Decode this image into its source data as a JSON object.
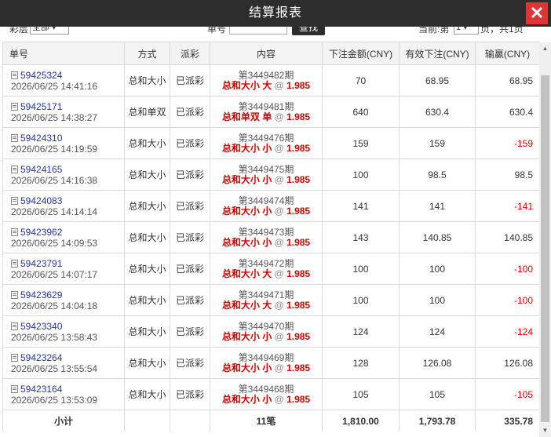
{
  "window": {
    "title": "结算报表",
    "close_label": "✕"
  },
  "filter": {
    "type_label": "彩层",
    "type_value": "全部",
    "order_label": "单号",
    "order_placeholder": "",
    "search_label": "查找",
    "page_label": "当前:第",
    "page_value": "1",
    "page_suffix": "页，共1页"
  },
  "table": {
    "headers": [
      "单号",
      "方式",
      "派彩",
      "内容",
      "下注金额(CNY)",
      "有效下注(CNY)",
      "输赢(CNY)"
    ],
    "rows": [
      {
        "id": "59425324",
        "time": "2026/06/25 14:41:16",
        "method": "总和大小",
        "status": "已派彩",
        "period": "第3449482期",
        "bet": "总和大小 大",
        "odds": "1.985",
        "amount": "70",
        "valid": "68.95",
        "win": "68.95"
      },
      {
        "id": "59425171",
        "time": "2026/06/25 14:38:27",
        "method": "总和单双",
        "status": "已派彩",
        "period": "第3449481期",
        "bet": "总和单双 单",
        "odds": "1.985",
        "amount": "640",
        "valid": "630.4",
        "win": "630.4"
      },
      {
        "id": "59424310",
        "time": "2026/06/25 14:19:59",
        "method": "总和大小",
        "status": "已派彩",
        "period": "第3449476期",
        "bet": "总和大小 小",
        "odds": "1.985",
        "amount": "159",
        "valid": "159",
        "win": "-159"
      },
      {
        "id": "59424165",
        "time": "2026/06/25 14:16:38",
        "method": "总和大小",
        "status": "已派彩",
        "period": "第3449475期",
        "bet": "总和大小 小",
        "odds": "1.985",
        "amount": "100",
        "valid": "98.5",
        "win": "98.5"
      },
      {
        "id": "59424083",
        "time": "2026/06/25 14:14:14",
        "method": "总和大小",
        "status": "已派彩",
        "period": "第3449474期",
        "bet": "总和大小 小",
        "odds": "1.985",
        "amount": "141",
        "valid": "141",
        "win": "-141"
      },
      {
        "id": "59423962",
        "time": "2026/06/25 14:09:53",
        "method": "总和大小",
        "status": "已派彩",
        "period": "第3449473期",
        "bet": "总和大小 小",
        "odds": "1.985",
        "amount": "143",
        "valid": "140.85",
        "win": "140.85"
      },
      {
        "id": "59423791",
        "time": "2026/06/25 14:07:17",
        "method": "总和大小",
        "status": "已派彩",
        "period": "第3449472期",
        "bet": "总和大小 大",
        "odds": "1.985",
        "amount": "100",
        "valid": "100",
        "win": "-100"
      },
      {
        "id": "59423629",
        "time": "2026/06/25 14:04:18",
        "method": "总和大小",
        "status": "已派彩",
        "period": "第3449471期",
        "bet": "总和大小 大",
        "odds": "1.985",
        "amount": "100",
        "valid": "100",
        "win": "-100"
      },
      {
        "id": "59423340",
        "time": "2026/06/25 13:58:43",
        "method": "总和大小",
        "status": "已派彩",
        "period": "第3449470期",
        "bet": "总和大小 小",
        "odds": "1.985",
        "amount": "124",
        "valid": "124",
        "win": "-124"
      },
      {
        "id": "59423264",
        "time": "2026/06/25 13:55:54",
        "method": "总和大小",
        "status": "已派彩",
        "period": "第3449469期",
        "bet": "总和大小 小",
        "odds": "1.985",
        "amount": "128",
        "valid": "126.08",
        "win": "126.08"
      },
      {
        "id": "59423164",
        "time": "2026/06/25 13:53:09",
        "method": "总和大小",
        "status": "已派彩",
        "period": "第3449468期",
        "bet": "总和大小 小",
        "odds": "1.985",
        "amount": "105",
        "valid": "105",
        "win": "-105"
      }
    ],
    "total": {
      "label": "小计",
      "count": "11笔",
      "amount": "1,810.00",
      "valid": "1,793.78",
      "win": "335.78"
    }
  },
  "colors": {
    "titlebar": "#2d2d2d",
    "close": "#e03434",
    "link": "#2233aa",
    "bet_red": "#d40000",
    "loss": "#e60000"
  }
}
